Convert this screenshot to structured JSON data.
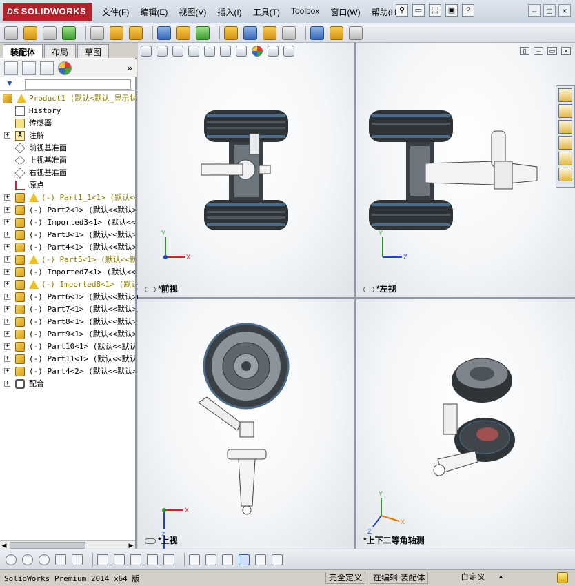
{
  "app": {
    "logo_text": "SOLIDWORKS",
    "logo_prefix": "DS"
  },
  "menu": [
    "文件(F)",
    "编辑(E)",
    "视图(V)",
    "插入(I)",
    "工具(T)",
    "Toolbox",
    "窗口(W)",
    "帮助(H)"
  ],
  "title_tools": {
    "help_label": "?"
  },
  "window_controls": [
    "–",
    "□",
    "×"
  ],
  "left_panel": {
    "tabs": [
      "装配体",
      "布局",
      "草图"
    ],
    "expand_label": "»",
    "filter_icon": "▼"
  },
  "tree": [
    {
      "icon": "asm",
      "warn": true,
      "text": "Product1 (默认<默认_显示状",
      "olive": true,
      "plus": false,
      "indent": 0
    },
    {
      "icon": "hist",
      "text": "History",
      "plus": false,
      "indent": 1
    },
    {
      "icon": "sensor",
      "text": "传感器",
      "plus": false,
      "indent": 1
    },
    {
      "icon": "note",
      "text": "注解",
      "plus": true,
      "indent": 1
    },
    {
      "icon": "plane",
      "text": "前视基准面",
      "plus": false,
      "indent": 1
    },
    {
      "icon": "plane",
      "text": "上视基准面",
      "plus": false,
      "indent": 1
    },
    {
      "icon": "plane",
      "text": "右视基准面",
      "plus": false,
      "indent": 1
    },
    {
      "icon": "origin",
      "text": "原点",
      "plus": false,
      "indent": 1
    },
    {
      "icon": "part",
      "warn": true,
      "text": "(-) Part1_1<1> (默认<<默",
      "olive": true,
      "plus": true,
      "indent": 1
    },
    {
      "icon": "part",
      "text": "(-) Part2<1> (默认<<默认>_",
      "plus": true,
      "indent": 1
    },
    {
      "icon": "part",
      "text": "(-) Imported3<1> (默认<<默",
      "plus": true,
      "indent": 1
    },
    {
      "icon": "part",
      "text": "(-) Part3<1> (默认<<默认>_",
      "plus": true,
      "indent": 1
    },
    {
      "icon": "part",
      "text": "(-) Part4<1> (默认<<默认>_",
      "plus": true,
      "indent": 1
    },
    {
      "icon": "part",
      "warn": true,
      "text": "(-) Part5<1> (默认<<默认",
      "olive": true,
      "plus": true,
      "indent": 1
    },
    {
      "icon": "part",
      "text": "(-) Imported7<1> (默认<<默",
      "plus": true,
      "indent": 1
    },
    {
      "icon": "part",
      "warn": true,
      "text": "(-) Imported8<1> (默认",
      "olive": true,
      "plus": true,
      "indent": 1
    },
    {
      "icon": "part",
      "text": "(-) Part6<1> (默认<<默认>_",
      "plus": true,
      "indent": 1
    },
    {
      "icon": "part",
      "text": "(-) Part7<1> (默认<<默认>_",
      "plus": true,
      "indent": 1
    },
    {
      "icon": "part",
      "text": "(-) Part8<1> (默认<<默认>_",
      "plus": true,
      "indent": 1
    },
    {
      "icon": "part",
      "text": "(-) Part9<1> (默认<<默认>_",
      "plus": true,
      "indent": 1
    },
    {
      "icon": "part",
      "text": "(-) Part10<1> (默认<<默认>",
      "plus": true,
      "indent": 1
    },
    {
      "icon": "part",
      "text": "(-) Part11<1> (默认<<默认>",
      "plus": true,
      "indent": 1
    },
    {
      "icon": "part",
      "text": "(-) Part4<2> (默认<<默认>_",
      "plus": true,
      "indent": 1
    },
    {
      "icon": "mate",
      "text": "配合",
      "plus": true,
      "indent": 1
    }
  ],
  "viewports": {
    "top_left": "*前视",
    "top_right": "*左视",
    "bottom_left": "*上视",
    "bottom_right": "*上下二等角轴测"
  },
  "axes": {
    "front": [
      "Y",
      "X"
    ],
    "left": [
      "Y",
      "Z"
    ],
    "top": [
      "X",
      "Z"
    ],
    "iso": [
      "Y",
      "X",
      "Z"
    ]
  },
  "status": {
    "product": "SolidWorks Premium 2014 x64 版",
    "defined": "完全定义",
    "editing": "在编辑 装配体",
    "units": "自定义",
    "arrow": "▲"
  }
}
